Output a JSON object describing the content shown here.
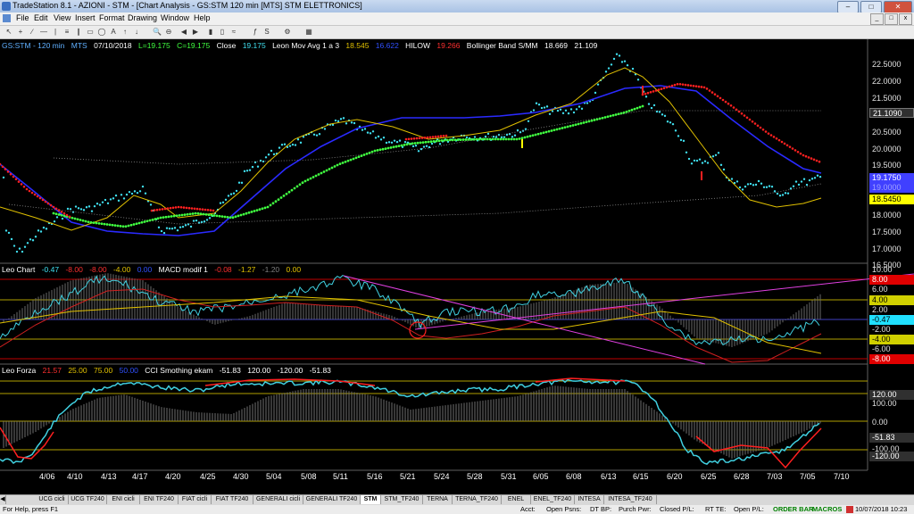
{
  "window": {
    "title": "TradeStation 8.1 - AZIONI - STM - [Chart Analysis - GS:STM 120 min [MTS] STM ELETTRONICS]"
  },
  "menu": [
    "File",
    "Edit",
    "View",
    "Insert",
    "Format",
    "Drawing",
    "Window",
    "Help"
  ],
  "price_legend": {
    "symbol": "GS:STM - 120 min",
    "exchange": "MTS",
    "date": "07/10/2018",
    "low": "L=19.175",
    "close_eq": "C=19.175",
    "close_label": "Close",
    "close_val": "19.175",
    "mov_avg_label": "Leon Mov Avg 1 a 3",
    "mov_avg_1": "18.545",
    "mov_avg_2": "16.622",
    "hilow_label": "HILOW",
    "hilow_val": "19.266",
    "bb_label": "Bollinger Band S/MM",
    "bb_1": "18.669",
    "bb_2": "21.109"
  },
  "macd_legend": {
    "name": "Leo Chart",
    "v1": "-0.47",
    "v2": "-8.00",
    "v3": "-8.00",
    "v4": "-4.00",
    "v5": "0.00",
    "macd_label": "MACD modif 1",
    "m1": "-0.08",
    "m2": "-1.27",
    "m3": "-1.20",
    "m4": "0.00"
  },
  "cci_legend": {
    "name": "Leo Forza",
    "v1": "21.57",
    "v2": "25.00",
    "v3": "75.00",
    "v4": "50.00",
    "cci_label": "CCI Smothing ekam",
    "c1": "-51.83",
    "c2": "120.00",
    "c3": "-120.00",
    "c4": "-51.83"
  },
  "price_axis": [
    "22.5000",
    "22.0000",
    "21.5000",
    "21.0000",
    "20.5000",
    "20.0000",
    "19.5000",
    "19.0000",
    "18.5000",
    "18.0000",
    "17.5000",
    "17.0000",
    "16.5000"
  ],
  "price_markers": {
    "bb_upper": "21.1090",
    "close": "19.1750",
    "low_box": "19.0000",
    "avg": "18.5450"
  },
  "macd_axis": [
    "10.00",
    "8.00",
    "6.00",
    "4.00",
    "2.00",
    "-0.47",
    "-2.00",
    "-4.00",
    "-6.00",
    "-8.00"
  ],
  "cci_axis": [
    "120.00",
    "100.00",
    "0.00",
    "-51.83",
    "-100.00",
    "-120.00"
  ],
  "x_dates": [
    "4/06",
    "4/10",
    "4/13",
    "4/17",
    "4/20",
    "4/25",
    "4/30",
    "5/04",
    "5/08",
    "5/11",
    "5/16",
    "5/21",
    "5/24",
    "5/28",
    "5/31",
    "6/05",
    "6/08",
    "6/13",
    "6/15",
    "6/20",
    "6/25",
    "6/28",
    "7/03",
    "7/05",
    "7/10"
  ],
  "tabs": [
    "UCG cicli",
    "UCG TF240",
    "ENI cicli",
    "ENI TF240",
    "FIAT cicli",
    "FIAT TF240",
    "GENERALI cicli",
    "GENERALI TF240",
    "STM",
    "STM_TF240",
    "TERNA",
    "TERNA_TF240",
    "ENEL",
    "ENEL_TF240",
    "INTESA",
    "INTESA_TF240"
  ],
  "active_tab": "STM",
  "status": {
    "help": "For Help, press F1",
    "acct": "Acct:",
    "open_psns": "Open Psns:",
    "dt_bp": "DT BP:",
    "purch_pwr": "Purch Pwr:",
    "closed_pl": "Closed P/L:",
    "rt_te": "RT TE:",
    "open_pl": "Open P/L:",
    "order_bar": "ORDER BAR",
    "macros": "MACROS",
    "datetime": "10/07/2018 10:23"
  },
  "colors": {
    "price_dots": "#40e0f0",
    "ma_blue": "#2a2aff",
    "ma_green": "#40ff40",
    "ma_yellow": "#e0c000",
    "sar_red": "#ff2020",
    "macd_magenta": "#e040e0",
    "cci_cyan": "#40d0e0",
    "grid_yellow": "#b0a000"
  }
}
